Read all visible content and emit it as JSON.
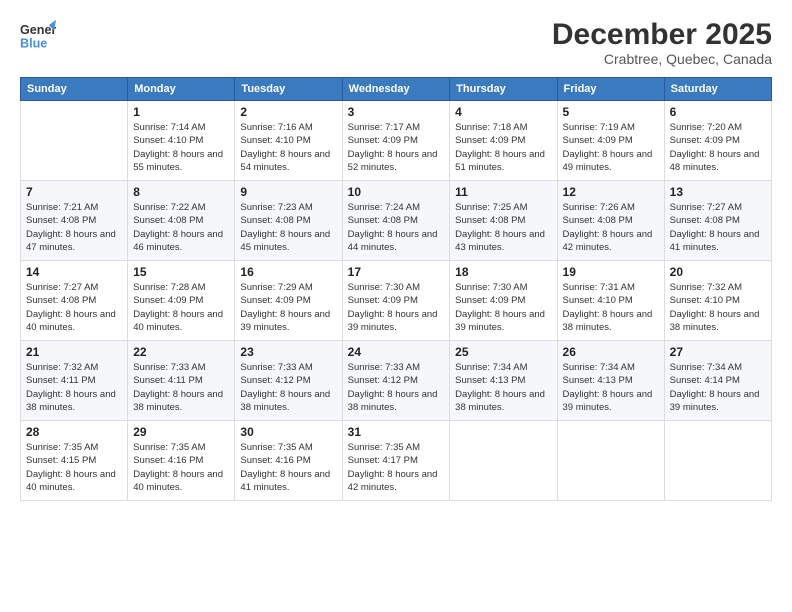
{
  "logo": {
    "line1": "General",
    "line2": "Blue"
  },
  "title": "December 2025",
  "subtitle": "Crabtree, Quebec, Canada",
  "weekdays": [
    "Sunday",
    "Monday",
    "Tuesday",
    "Wednesday",
    "Thursday",
    "Friday",
    "Saturday"
  ],
  "weeks": [
    [
      {
        "day": "",
        "sunrise": "",
        "sunset": "",
        "daylight": ""
      },
      {
        "day": "1",
        "sunrise": "Sunrise: 7:14 AM",
        "sunset": "Sunset: 4:10 PM",
        "daylight": "Daylight: 8 hours and 55 minutes."
      },
      {
        "day": "2",
        "sunrise": "Sunrise: 7:16 AM",
        "sunset": "Sunset: 4:10 PM",
        "daylight": "Daylight: 8 hours and 54 minutes."
      },
      {
        "day": "3",
        "sunrise": "Sunrise: 7:17 AM",
        "sunset": "Sunset: 4:09 PM",
        "daylight": "Daylight: 8 hours and 52 minutes."
      },
      {
        "day": "4",
        "sunrise": "Sunrise: 7:18 AM",
        "sunset": "Sunset: 4:09 PM",
        "daylight": "Daylight: 8 hours and 51 minutes."
      },
      {
        "day": "5",
        "sunrise": "Sunrise: 7:19 AM",
        "sunset": "Sunset: 4:09 PM",
        "daylight": "Daylight: 8 hours and 49 minutes."
      },
      {
        "day": "6",
        "sunrise": "Sunrise: 7:20 AM",
        "sunset": "Sunset: 4:09 PM",
        "daylight": "Daylight: 8 hours and 48 minutes."
      }
    ],
    [
      {
        "day": "7",
        "sunrise": "Sunrise: 7:21 AM",
        "sunset": "Sunset: 4:08 PM",
        "daylight": "Daylight: 8 hours and 47 minutes."
      },
      {
        "day": "8",
        "sunrise": "Sunrise: 7:22 AM",
        "sunset": "Sunset: 4:08 PM",
        "daylight": "Daylight: 8 hours and 46 minutes."
      },
      {
        "day": "9",
        "sunrise": "Sunrise: 7:23 AM",
        "sunset": "Sunset: 4:08 PM",
        "daylight": "Daylight: 8 hours and 45 minutes."
      },
      {
        "day": "10",
        "sunrise": "Sunrise: 7:24 AM",
        "sunset": "Sunset: 4:08 PM",
        "daylight": "Daylight: 8 hours and 44 minutes."
      },
      {
        "day": "11",
        "sunrise": "Sunrise: 7:25 AM",
        "sunset": "Sunset: 4:08 PM",
        "daylight": "Daylight: 8 hours and 43 minutes."
      },
      {
        "day": "12",
        "sunrise": "Sunrise: 7:26 AM",
        "sunset": "Sunset: 4:08 PM",
        "daylight": "Daylight: 8 hours and 42 minutes."
      },
      {
        "day": "13",
        "sunrise": "Sunrise: 7:27 AM",
        "sunset": "Sunset: 4:08 PM",
        "daylight": "Daylight: 8 hours and 41 minutes."
      }
    ],
    [
      {
        "day": "14",
        "sunrise": "Sunrise: 7:27 AM",
        "sunset": "Sunset: 4:08 PM",
        "daylight": "Daylight: 8 hours and 40 minutes."
      },
      {
        "day": "15",
        "sunrise": "Sunrise: 7:28 AM",
        "sunset": "Sunset: 4:09 PM",
        "daylight": "Daylight: 8 hours and 40 minutes."
      },
      {
        "day": "16",
        "sunrise": "Sunrise: 7:29 AM",
        "sunset": "Sunset: 4:09 PM",
        "daylight": "Daylight: 8 hours and 39 minutes."
      },
      {
        "day": "17",
        "sunrise": "Sunrise: 7:30 AM",
        "sunset": "Sunset: 4:09 PM",
        "daylight": "Daylight: 8 hours and 39 minutes."
      },
      {
        "day": "18",
        "sunrise": "Sunrise: 7:30 AM",
        "sunset": "Sunset: 4:09 PM",
        "daylight": "Daylight: 8 hours and 39 minutes."
      },
      {
        "day": "19",
        "sunrise": "Sunrise: 7:31 AM",
        "sunset": "Sunset: 4:10 PM",
        "daylight": "Daylight: 8 hours and 38 minutes."
      },
      {
        "day": "20",
        "sunrise": "Sunrise: 7:32 AM",
        "sunset": "Sunset: 4:10 PM",
        "daylight": "Daylight: 8 hours and 38 minutes."
      }
    ],
    [
      {
        "day": "21",
        "sunrise": "Sunrise: 7:32 AM",
        "sunset": "Sunset: 4:11 PM",
        "daylight": "Daylight: 8 hours and 38 minutes."
      },
      {
        "day": "22",
        "sunrise": "Sunrise: 7:33 AM",
        "sunset": "Sunset: 4:11 PM",
        "daylight": "Daylight: 8 hours and 38 minutes."
      },
      {
        "day": "23",
        "sunrise": "Sunrise: 7:33 AM",
        "sunset": "Sunset: 4:12 PM",
        "daylight": "Daylight: 8 hours and 38 minutes."
      },
      {
        "day": "24",
        "sunrise": "Sunrise: 7:33 AM",
        "sunset": "Sunset: 4:12 PM",
        "daylight": "Daylight: 8 hours and 38 minutes."
      },
      {
        "day": "25",
        "sunrise": "Sunrise: 7:34 AM",
        "sunset": "Sunset: 4:13 PM",
        "daylight": "Daylight: 8 hours and 38 minutes."
      },
      {
        "day": "26",
        "sunrise": "Sunrise: 7:34 AM",
        "sunset": "Sunset: 4:13 PM",
        "daylight": "Daylight: 8 hours and 39 minutes."
      },
      {
        "day": "27",
        "sunrise": "Sunrise: 7:34 AM",
        "sunset": "Sunset: 4:14 PM",
        "daylight": "Daylight: 8 hours and 39 minutes."
      }
    ],
    [
      {
        "day": "28",
        "sunrise": "Sunrise: 7:35 AM",
        "sunset": "Sunset: 4:15 PM",
        "daylight": "Daylight: 8 hours and 40 minutes."
      },
      {
        "day": "29",
        "sunrise": "Sunrise: 7:35 AM",
        "sunset": "Sunset: 4:16 PM",
        "daylight": "Daylight: 8 hours and 40 minutes."
      },
      {
        "day": "30",
        "sunrise": "Sunrise: 7:35 AM",
        "sunset": "Sunset: 4:16 PM",
        "daylight": "Daylight: 8 hours and 41 minutes."
      },
      {
        "day": "31",
        "sunrise": "Sunrise: 7:35 AM",
        "sunset": "Sunset: 4:17 PM",
        "daylight": "Daylight: 8 hours and 42 minutes."
      },
      {
        "day": "",
        "sunrise": "",
        "sunset": "",
        "daylight": ""
      },
      {
        "day": "",
        "sunrise": "",
        "sunset": "",
        "daylight": ""
      },
      {
        "day": "",
        "sunrise": "",
        "sunset": "",
        "daylight": ""
      }
    ]
  ]
}
